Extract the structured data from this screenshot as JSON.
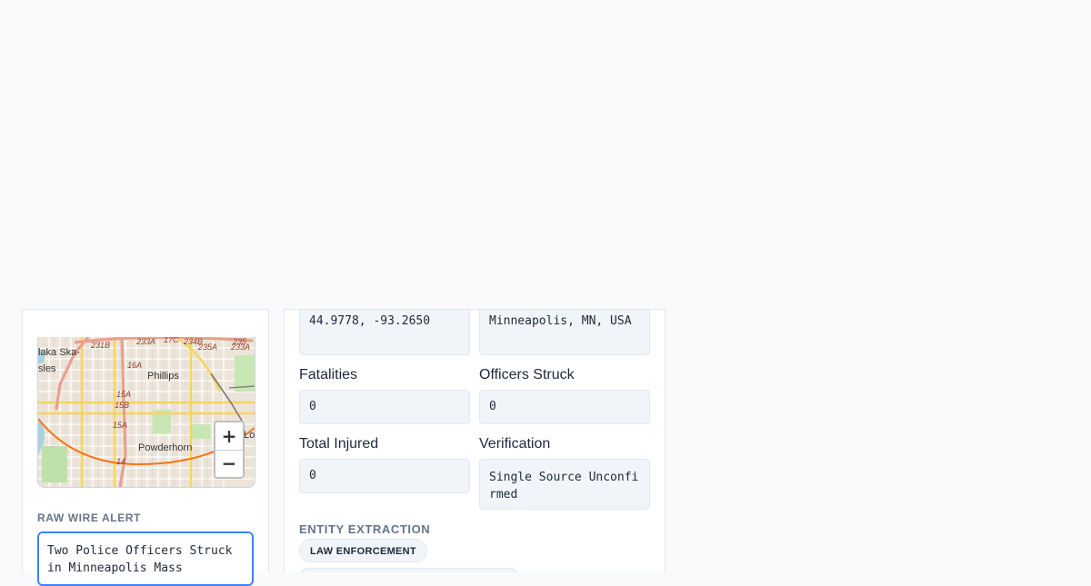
{
  "left_panel": {
    "raw_wire_alert_label": "RAW WIRE ALERT",
    "raw_wire_alert_text": "Two Police Officers Struck in Minneapolis Mass",
    "map": {
      "zoom_in": "+",
      "zoom_out": "−",
      "labels": [
        "Phillips",
        "Powderhorn",
        "laka Ska-",
        "sles",
        "16A",
        "15A",
        "15B",
        "15A",
        "231B",
        "233A",
        "17C",
        "234B",
        "235A",
        "235",
        "Lo",
        "14"
      ],
      "radius_color": "#f97316"
    }
  },
  "right_panel": {
    "coordinates_value": "44.9778, -93.2650",
    "location_value": "Minneapolis, MN, USA",
    "fatalities_label": "Fatalities",
    "fatalities_value": "0",
    "officers_struck_label": "Officers Struck",
    "officers_struck_value": "0",
    "total_injured_label": "Total Injured",
    "total_injured_value": "0",
    "verification_label": "Verification",
    "verification_value": "Single Source Unconfirmed",
    "entity_extraction_label": "ENTITY EXTRACTION",
    "entity_tags": [
      "LAW ENFORCEMENT"
    ]
  }
}
